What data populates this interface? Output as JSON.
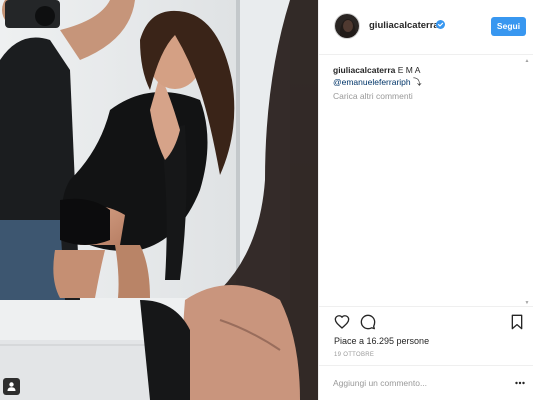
{
  "post": {
    "username": "giuliacalcaterra",
    "follow_label": "Segui",
    "caption_username": "giuliacalcaterra",
    "caption_text": " E M A",
    "caption_mention": "@emanueleferrariph",
    "caption_emoji": " ⤵",
    "load_more_comments": "Carica altri commenti",
    "likes": "Piace a 16.295 persone",
    "date": "19 OTTOBRE",
    "comment_placeholder": "Aggiungi un commento..."
  },
  "icons": {
    "verified": "verified-badge-icon",
    "like": "heart-icon",
    "comment": "comment-bubble-icon",
    "save": "bookmark-icon",
    "more": "more-options-icon",
    "tagged_people": "person-tag-icon"
  },
  "colors": {
    "follow_button": "#3897f0",
    "verified_badge": "#3897f0",
    "primary_text": "#262626",
    "secondary_text": "#999999",
    "mention": "#003569"
  }
}
